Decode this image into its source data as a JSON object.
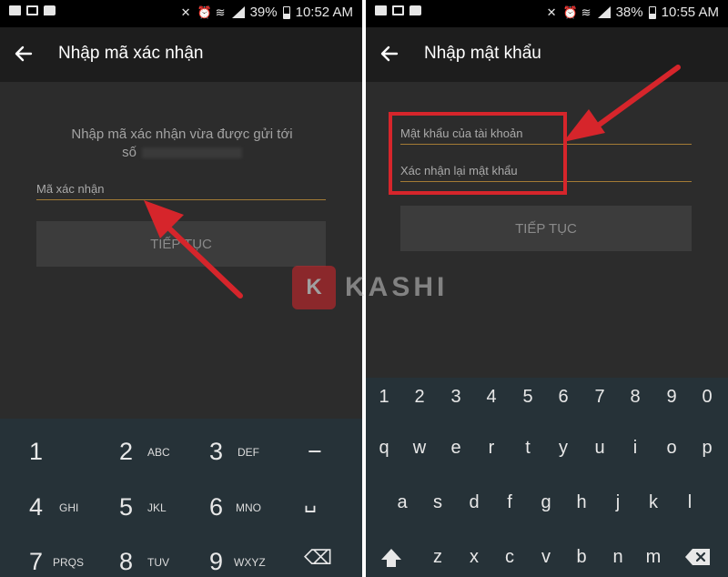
{
  "left": {
    "status": {
      "battery": "39%",
      "time": "10:52 AM"
    },
    "title": "Nhập mã xác nhận",
    "instruction_line1": "Nhập mã xác nhận vừa được gửi tới",
    "instruction_line2": "số",
    "field_placeholder": "Mã xác nhận",
    "button": "TIẾP TỤC",
    "keypad": [
      {
        "digit": "1",
        "letters": ""
      },
      {
        "digit": "2",
        "letters": "ABC"
      },
      {
        "digit": "3",
        "letters": "DEF"
      },
      {
        "digit": "−",
        "letters": ""
      },
      {
        "digit": "4",
        "letters": "GHI"
      },
      {
        "digit": "5",
        "letters": "JKL"
      },
      {
        "digit": "6",
        "letters": "MNO"
      },
      {
        "digit": "␣",
        "letters": ""
      },
      {
        "digit": "7",
        "letters": "PRQS"
      },
      {
        "digit": "8",
        "letters": "TUV"
      },
      {
        "digit": "9",
        "letters": "WXYZ"
      },
      {
        "digit": "⌫",
        "letters": ""
      }
    ]
  },
  "right": {
    "status": {
      "battery": "38%",
      "time": "10:55 AM"
    },
    "title": "Nhập mật khẩu",
    "field1_placeholder": "Mật khẩu của tài khoản",
    "field2_placeholder": "Xác nhận lại mật khẩu",
    "button": "TIẾP TỤC",
    "number_row": [
      "1",
      "2",
      "3",
      "4",
      "5",
      "6",
      "7",
      "8",
      "9",
      "0"
    ],
    "row1": [
      "q",
      "w",
      "e",
      "r",
      "t",
      "y",
      "u",
      "i",
      "o",
      "p"
    ],
    "row2": [
      "a",
      "s",
      "d",
      "f",
      "g",
      "h",
      "j",
      "k",
      "l"
    ],
    "row3": [
      "z",
      "x",
      "c",
      "v",
      "b",
      "n",
      "m"
    ]
  },
  "watermark": {
    "letter": "K",
    "text": "KASHI"
  },
  "colors": {
    "accent_line": "#a37b35",
    "highlight": "#d6252b",
    "keyboard_bg": "#263238"
  }
}
